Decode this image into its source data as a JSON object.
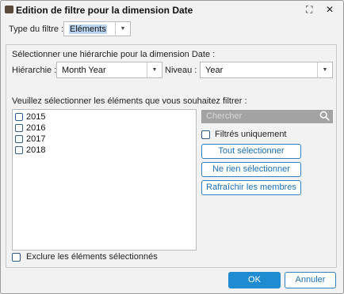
{
  "window": {
    "title": "Edition de filtre pour la dimension Date",
    "maximize_glyph": "⛶",
    "close_glyph": "✕"
  },
  "filter_type": {
    "label": "Type du filtre :",
    "value": "Eléments"
  },
  "hierarchy_section": {
    "heading": "Sélectionner une hiérarchie pour la dimension Date :",
    "hierarchy_label": "Hiérarchie :",
    "hierarchy_value": "Month Year",
    "level_label": "Niveau :",
    "level_value": "Year"
  },
  "elements": {
    "heading": "Veuillez sélectionner les éléments que vous souhaitez filtrer :",
    "items": [
      "2015",
      "2016",
      "2017",
      "2018"
    ]
  },
  "search": {
    "placeholder": "Chercher"
  },
  "options": {
    "filtered_only_label": "Filtrés uniquement",
    "select_all_label": "Tout sélectionner",
    "select_none_label": "Ne rien sélectionner",
    "refresh_label": "Rafraîchir les membres",
    "exclude_label": "Exclure les éléments sélectionnés"
  },
  "footer": {
    "ok_label": "OK",
    "cancel_label": "Annuler"
  },
  "colors": {
    "accent": "#1f8bd1",
    "outline": "#2f7fc1",
    "search_bg": "#a3a3a3"
  }
}
